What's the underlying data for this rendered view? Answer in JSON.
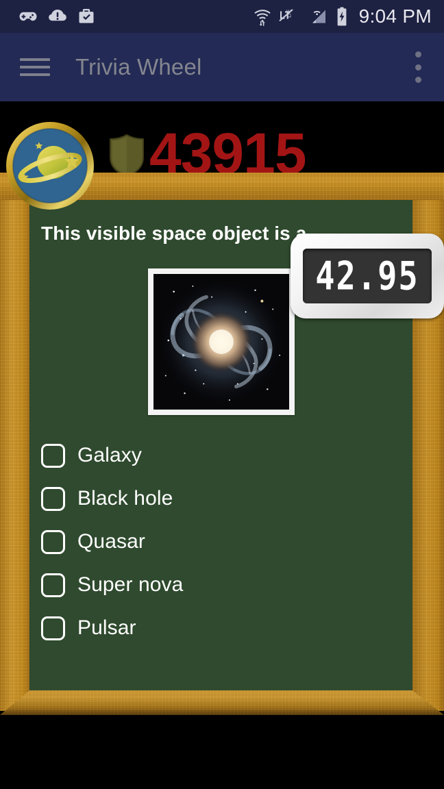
{
  "status_bar": {
    "icons": [
      "game-controller-icon",
      "alert-circle-icon",
      "briefcase-check-icon"
    ],
    "right_icons": [
      "wifi-transfer-icon",
      "lte-muted-icon",
      "cell-signal-icon",
      "battery-charging-icon"
    ],
    "clock": "9:04 PM",
    "background_color": "#1d2142"
  },
  "app_bar": {
    "menu_icon": "hamburger-menu-icon",
    "title": "Trivia Wheel",
    "overflow_icon": "more-vertical-icon",
    "background_color": "#232a55",
    "title_color": "#84868f"
  },
  "game": {
    "badge_icon": "saturn-planet-badge-icon",
    "shield_icon": "shield-icon",
    "score": "43915",
    "score_color": "#a31515",
    "timer": "42.95",
    "board_color": "#2f4a2e",
    "frame_color": "#c99126"
  },
  "question": {
    "text": "This visible space object is a",
    "image_alt": "spiral-galaxy-photo",
    "options": [
      {
        "label": "Galaxy",
        "checked": false
      },
      {
        "label": "Black hole",
        "checked": false
      },
      {
        "label": "Quasar",
        "checked": false
      },
      {
        "label": "Super nova",
        "checked": false
      },
      {
        "label": "Pulsar",
        "checked": false
      }
    ]
  }
}
